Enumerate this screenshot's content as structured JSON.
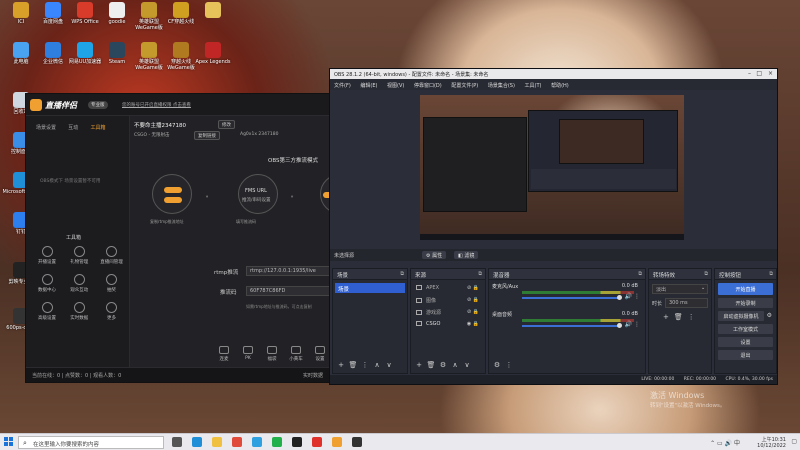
{
  "desktop": {
    "icons": [
      {
        "label": "ICI",
        "color": "#d8a028"
      },
      {
        "label": "百度网盘",
        "color": "#3a86ff"
      },
      {
        "label": "WPS Office",
        "color": "#d83b2a"
      },
      {
        "label": "goodie",
        "color": "#eeeeee"
      },
      {
        "label": "英雄联盟WeGame版",
        "color": "#c49a2c"
      },
      {
        "label": "CF穿越火线",
        "color": "#d0a020"
      },
      {
        "label": "",
        "color": "#e7c25a"
      },
      {
        "label": "此电脑",
        "color": "#4aa3f0"
      },
      {
        "label": "企业微信",
        "color": "#2e7fe0"
      },
      {
        "label": "网易UU加速器",
        "color": "#1fa4e8"
      },
      {
        "label": "Steam",
        "color": "#2a475e"
      },
      {
        "label": "英雄联盟WeGame版",
        "color": "#c49a2c"
      },
      {
        "label": "穿越火线WeGame版",
        "color": "#b07a20"
      },
      {
        "label": "Apex Legends",
        "color": "#c12626"
      },
      {
        "label": "回收站",
        "color": "#cfd8e0"
      },
      {
        "label": "控制面板",
        "color": "#3a8ee8"
      },
      {
        "label": "Microsoft Edge",
        "color": "#1f8fd8"
      },
      {
        "label": "钉钉",
        "color": "#2d7ff0"
      },
      {
        "label": "剪映专业版",
        "color": "#222222"
      },
      {
        "label": "600ps-dio...",
        "color": "#333333"
      }
    ]
  },
  "live_app": {
    "logo": "直播伴侣",
    "badge": "专业版",
    "notice": "您的账号已开启直播权限 点击查看",
    "left_tabs": [
      "场景设置",
      "互动",
      "工具箱"
    ],
    "left_placeholder": "OBS模式下 场景设置暂不可用",
    "tool_section": "工具箱",
    "tools": [
      "开播设置",
      "礼物管理",
      "直播间管理",
      "数据中心",
      "观众互动",
      "抽奖",
      "高级设置",
      "实时数据",
      "更多"
    ],
    "room_title": "不要命主播2347180",
    "room_btn": "修改",
    "category": "CSGO - 无限射击",
    "room_id_label": "Ag0x1x 2347180",
    "share_btn": "复制链接",
    "mode_title": "OBS第三方推流模式",
    "flow_nodes": [
      "复制rtmp推流地址",
      "FMS URL",
      "填写推流码",
      "直播中"
    ],
    "fms_label": "FMS URL",
    "stream_label": "推流/串码设置",
    "rtmp_label": "rtmp推流",
    "rtmp_value": "rtmp://127.0.0.1:1935/live",
    "key_label": "推流码",
    "key_value": "60F787C86FD",
    "key_hint": "如需rtmp地址与推流码，可点击复制",
    "copy_btn": "复制",
    "bottom_tools": [
      "连麦",
      "PK",
      "福袋",
      "小黄车",
      "设置"
    ],
    "status_text": "当前在线：0 | 点赞数：0 | 观看人数：0",
    "status_right": "实时数据"
  },
  "obs": {
    "title": "OBS 28.1.2 (64-bit, windows) - 配置文件: 未命名 - 场景集: 未命名",
    "menu": [
      "文件(F)",
      "编辑(E)",
      "视图(V)",
      "停靠窗口(D)",
      "配置文件(P)",
      "场景集合(S)",
      "工具(T)",
      "帮助(H)"
    ],
    "context_label": "未选择源",
    "ctx_props": "属性",
    "ctx_filters": "滤镜",
    "scenes_title": "场景",
    "scenes": [
      "场景"
    ],
    "sources_title": "来源",
    "sources": [
      "APEX",
      "图像",
      "游戏源",
      "CSGO"
    ],
    "mixer_title": "混音器",
    "mixer_tracks": [
      {
        "name": "麦克风/Aux",
        "db": "0.0 dB",
        "volume": 1.0
      },
      {
        "name": "桌面音频",
        "db": "0.0 dB",
        "volume": 1.0
      }
    ],
    "transitions_title": "转场特效",
    "transition_value": "淡出",
    "duration_label": "时长",
    "duration_value": "300 ms",
    "controls_title": "控制按钮",
    "controls": [
      "开始直播",
      "开始录制",
      "启动虚拟摄像机",
      "工作室模式",
      "设置",
      "退出"
    ],
    "status": {
      "live": "LIVE: 00:00:00",
      "rec": "REC: 00:00:00",
      "cpu": "CPU: 0.4%, 30.00 fps"
    }
  },
  "watermark": {
    "line1": "激活 Windows",
    "line2": "转到\"设置\"以激活 Windows。"
  },
  "taskbar": {
    "search_placeholder": "在这里输入你要搜索的内容",
    "time": "上午10:31",
    "date": "10/12/2022",
    "apps": [
      {
        "name": "task-view",
        "color": "#555555"
      },
      {
        "name": "edge",
        "color": "#1f8fd8"
      },
      {
        "name": "file-explorer",
        "color": "#f0c040"
      },
      {
        "name": "chrome",
        "color": "#e04a3a"
      },
      {
        "name": "qq-browser",
        "color": "#2fa0e0"
      },
      {
        "name": "wechat",
        "color": "#22b04b"
      },
      {
        "name": "obs",
        "color": "#222222"
      },
      {
        "name": "live-companion",
        "color": "#e0302a"
      },
      {
        "name": "folder",
        "color": "#f0a030"
      },
      {
        "name": "obs-2",
        "color": "#333333"
      }
    ]
  },
  "colors": {
    "accent_orange": "#f0a030",
    "obs_blue": "#3c6fd6",
    "obs_bg": "#2b2e38"
  }
}
